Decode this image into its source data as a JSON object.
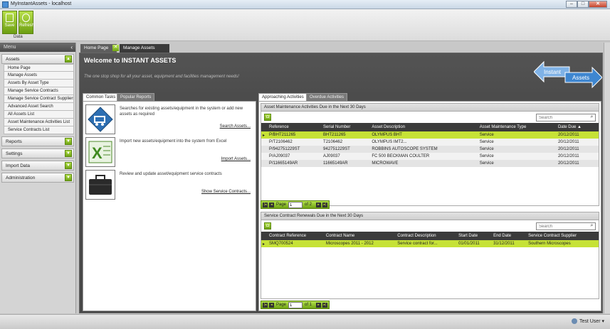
{
  "window": {
    "title": "MyInstantAssets - localhost",
    "controls": {
      "minimize": "–",
      "maximize": "□",
      "close": "✕"
    }
  },
  "ribbon": {
    "save_label": "Save",
    "refresh_label": "Refresh",
    "group_label": "Data"
  },
  "sidebar": {
    "menu_label": "Menu",
    "collapse_glyph": "‹",
    "sections": [
      {
        "label": "Assets",
        "expanded": true,
        "items": [
          "Home Page",
          "Manage Assets",
          "Assets By Asset Type",
          "Manage Service Contracts",
          "Manage Service Contract Suppliers",
          "Advanced Asset Search",
          "All Assets List",
          "Asset Maintenance Activities List",
          "Service Contracts List"
        ]
      },
      {
        "label": "Reports",
        "expanded": false
      },
      {
        "label": "Settings",
        "expanded": false
      },
      {
        "label": "Import Data",
        "expanded": false
      },
      {
        "label": "Administration",
        "expanded": false
      }
    ]
  },
  "tabs": {
    "home": "Home Page",
    "close_glyph": "✕",
    "manage": "Manage Assets"
  },
  "welcome": {
    "title": "Welcome to INSTANT ASSETS",
    "tagline": "The one stop shop for all your asset, equipment and facilities management needs!",
    "logo_left": "Instant",
    "logo_right": "Assets"
  },
  "left_panel": {
    "tabs": [
      "Common Tasks",
      "Popular Reports"
    ],
    "tasks": [
      {
        "desc": "Searches for existing assets/equipment in the system or add new assets as required",
        "link": "Search Assets..."
      },
      {
        "desc": "Import new assets/equipment into the system from Excel",
        "link": "Import Assets..."
      },
      {
        "desc": "Review and update asset/equipment service contracts",
        "link": "Show Service Contracts..."
      }
    ]
  },
  "right_panel": {
    "tabs": [
      "Approaching Activities",
      "Overdue Activities"
    ],
    "maintenance": {
      "title": "Asset Maintenance Activities Due in the Next 30 Days",
      "search_placeholder": "Search",
      "columns": [
        "Reference",
        "Serial Number",
        "Asset Description",
        "Asset Maintenance Type",
        "Date Due ▲"
      ],
      "rows": [
        [
          "P/BHT211265",
          "BHT211265",
          "OLYMPUS BHT",
          "Service",
          "20/12/2011"
        ],
        [
          "P/T2106462",
          "T2106462",
          "OLYMPUS IMT2...",
          "Service",
          "20/12/2011"
        ],
        [
          "P/942751229ST",
          "942751229ST",
          "ROBBINS AUTOSCOPE SYSTEM",
          "Service",
          "20/12/2011"
        ],
        [
          "P/AJ09037",
          "AJ09037",
          "FC 500 BECKMAN COULTER",
          "Service",
          "20/12/2011"
        ],
        [
          "P/11665149AR",
          "11665149AR",
          "MICROWAVE",
          "Service",
          "20/12/2011"
        ]
      ],
      "pager": {
        "page_label": "Page",
        "current": "1",
        "of_label": "of 2"
      }
    },
    "contracts": {
      "title": "Service Contract Renewals Due in the Next 30 Days",
      "search_placeholder": "Search",
      "columns": [
        "Contract Reference",
        "Contract Name",
        "Contract Description",
        "Start Date",
        "End Date",
        "Service Contract Supplier"
      ],
      "rows": [
        [
          "SMQ700524",
          "Microscopes 2011 - 2012",
          "Service contract for...",
          "01/01/2011",
          "31/12/2011",
          "Southern Microscopes"
        ]
      ],
      "pager": {
        "page_label": "Page",
        "current": "1",
        "of_label": "of 1"
      }
    }
  },
  "status": {
    "user": "Test User"
  },
  "colors": {
    "accent_green": "#c6e236",
    "dark_header": "#3b3b3b"
  }
}
